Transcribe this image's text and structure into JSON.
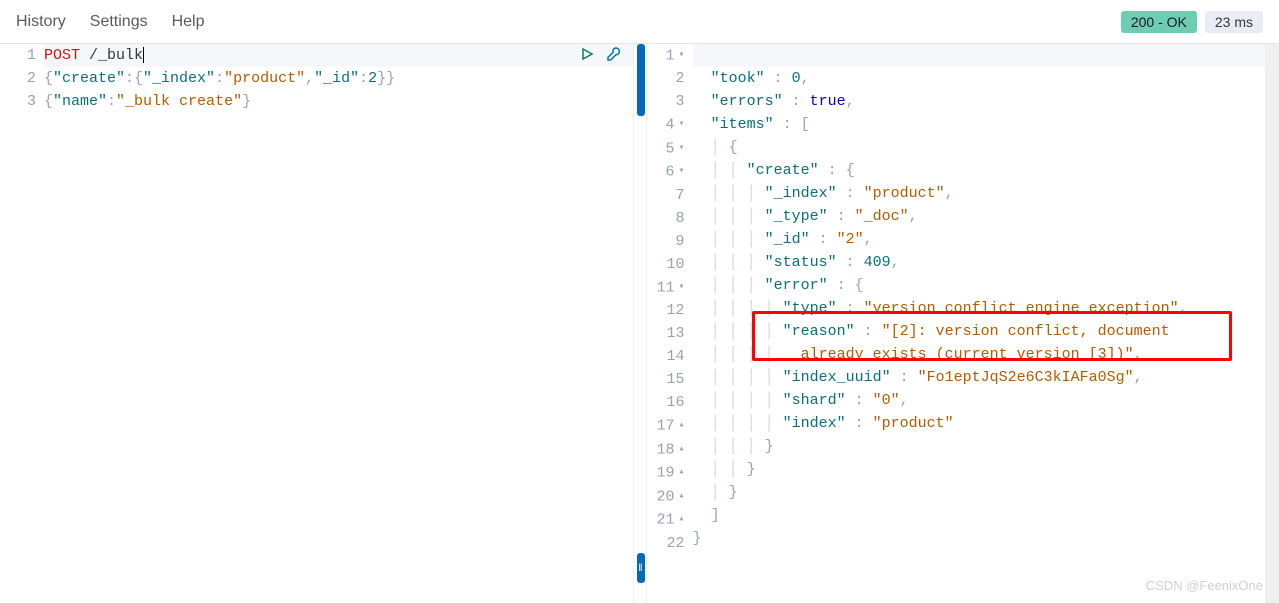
{
  "topbar": {
    "history": "History",
    "settings": "Settings",
    "help": "Help",
    "status": "200 - OK",
    "time": "23 ms"
  },
  "left": {
    "lines": [
      "1",
      "2",
      "3"
    ],
    "method": "POST",
    "path": " /_bulk",
    "line2": {
      "k1": "\"create\"",
      "k2": "\"_index\"",
      "v2": "\"product\"",
      "k3": "\"_id\"",
      "v3": "2"
    },
    "line3": {
      "k1": "\"name\"",
      "v1": "\"_bulk create\""
    }
  },
  "right": {
    "lines": [
      "1",
      "2",
      "3",
      "4",
      "5",
      "6",
      "7",
      "8",
      "9",
      "10",
      "11",
      "12",
      "13",
      "",
      "14",
      "15",
      "16",
      "17",
      "18",
      "19",
      "20",
      "21",
      "22"
    ],
    "took_k": "\"took\"",
    "took_v": "0",
    "errors_k": "\"errors\"",
    "errors_v": "true",
    "items_k": "\"items\"",
    "create_k": "\"create\"",
    "index_k": "\"_index\"",
    "index_v": "\"product\"",
    "type_k": "\"_type\"",
    "type_v": "\"_doc\"",
    "id_k": "\"_id\"",
    "id_v": "\"2\"",
    "status_k": "\"status\"",
    "status_v": "409",
    "error_k": "\"error\"",
    "etype_k": "\"type\"",
    "etype_v": "\"version_conflict_engine_exception\"",
    "reason_k": "\"reason\"",
    "reason_v1": "\"[2]: version conflict, document",
    "reason_v2": "already exists (current version [3])\"",
    "idxuuid_k": "\"index_uuid\"",
    "idxuuid_v": "\"Fo1eptJqS2e6C3kIAFa0Sg\"",
    "shard_k": "\"shard\"",
    "shard_v": "\"0\"",
    "idx2_k": "\"index\"",
    "idx2_v": "\"product\""
  },
  "watermark": "CSDN @FeenixOne"
}
